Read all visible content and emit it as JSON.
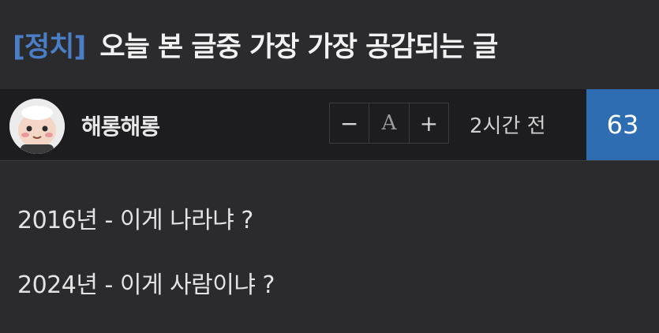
{
  "post": {
    "category": "[정치]",
    "title": "오늘 본 글중 가장 가장 공감되는 글",
    "author": "해롱해롱",
    "time": "2시간 전",
    "comment_count": "63",
    "body": [
      "2016년 - 이게 나라냐 ?",
      "2024년 - 이게 사람이냐 ?"
    ]
  },
  "font_controls": {
    "decrease": "−",
    "label": "A",
    "increase": "+"
  },
  "colors": {
    "background": "#2b2b2d",
    "meta_bar": "#1d1d1f",
    "category": "#4a7fc7",
    "count_badge": "#2f6db2"
  },
  "icons": {
    "avatar": "cartoon-face-avatar"
  }
}
